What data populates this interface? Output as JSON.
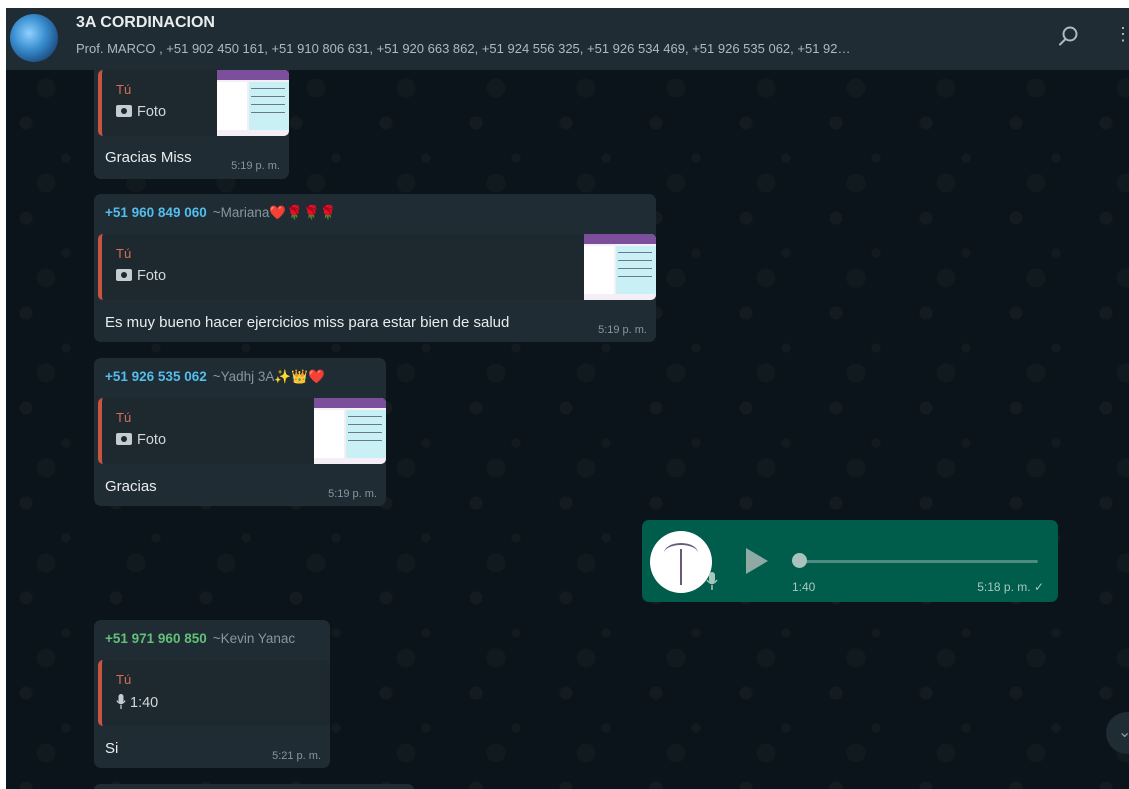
{
  "header": {
    "title": "3A CORDINACION",
    "subtitle": "Prof. MARCO , +51 902 450 161, +51 910 806 631, +51 920 663 862, +51 924 556 325, +51 926 534 469, +51 926 535 062, +51 92…",
    "more_label": "⋮"
  },
  "colors": {
    "incoming_bubble": "#202c33",
    "outgoing_bubble": "#005c4b",
    "quote_accent": "#c9543f",
    "sender_blue": "#53bdeb",
    "sender_green": "#62c07a"
  },
  "messages": [
    {
      "quote_author": "Tú",
      "quote_text": "Foto",
      "text": "Gracias Miss",
      "time": "5:19 p. m."
    },
    {
      "phone": "+51 960 849 060",
      "name": "~Mariana❤️🌹🌹🌹",
      "quote_author": "Tú",
      "quote_text": "Foto",
      "text": "Es muy bueno hacer ejercicios miss para estar bien de salud",
      "time": "5:19 p. m."
    },
    {
      "phone": "+51 926 535 062",
      "name": "~Yadhj 3A✨👑❤️",
      "quote_author": "Tú",
      "quote_text": "Foto",
      "text": "Gracias",
      "time": "5:19 p. m."
    },
    {
      "phone": "+51 971 960 850",
      "name": "~Kevin Yanac",
      "quote_author": "Tú",
      "quote_text": "1:40",
      "text": "Si",
      "time": "5:21 p. m."
    }
  ],
  "voice_note": {
    "duration": "1:40",
    "time": "5:18 p. m.",
    "status": "✓",
    "progress": 0
  }
}
